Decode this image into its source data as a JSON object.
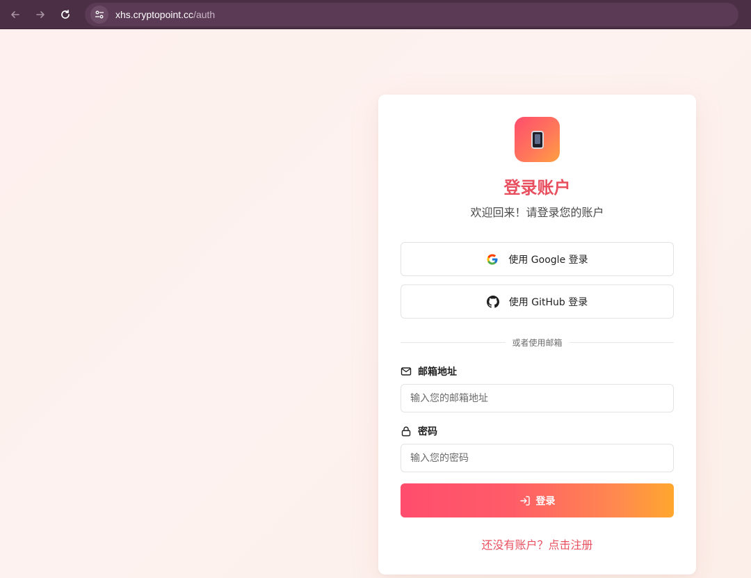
{
  "browser": {
    "url_host": "xhs.cryptopoint.cc",
    "url_path": "/auth"
  },
  "card": {
    "title": "登录账户",
    "subtitle": "欢迎回来！请登录您的账户",
    "google_button": "使用 Google 登录",
    "github_button": "使用 GitHub 登录",
    "divider_text": "或者使用邮箱",
    "email_label": "邮箱地址",
    "email_placeholder": "输入您的邮箱地址",
    "email_value": "",
    "password_label": "密码",
    "password_placeholder": "输入您的密码",
    "password_value": "",
    "login_button": "登录",
    "register_link": "还没有账户？点击注册"
  },
  "icons": {
    "logo": "phone-icon",
    "google": "google-icon",
    "github": "github-icon",
    "email": "mail-icon",
    "password": "lock-icon",
    "login": "sign-in-icon"
  },
  "colors": {
    "accent": "#e8505f",
    "gradient_start": "#ff4d6d",
    "gradient_end": "#ffa72e",
    "browser_bar": "#4b2f45"
  }
}
